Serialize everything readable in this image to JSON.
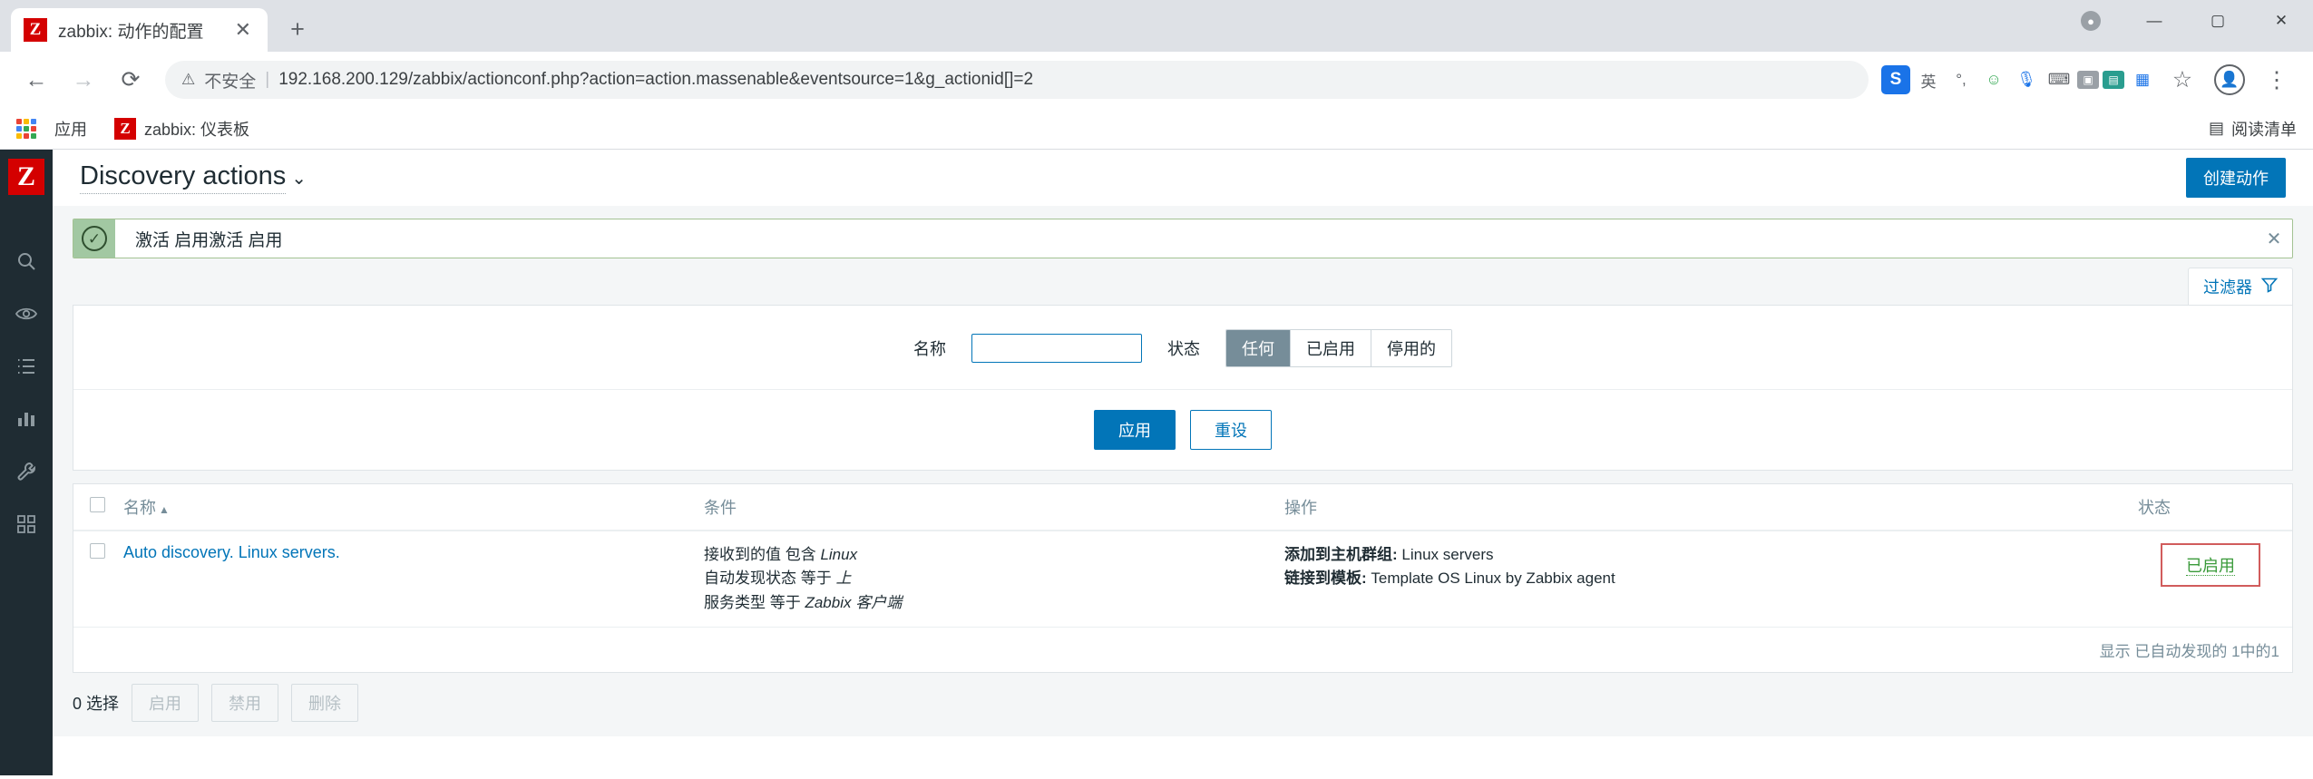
{
  "browser": {
    "tab": {
      "title": "zabbix: 动作的配置",
      "favicon_letter": "Z",
      "close_icon": "✕"
    },
    "new_tab_label": "+",
    "window_controls": {
      "minimize": "—",
      "maximize": "▢",
      "close": "✕",
      "record_dot": "●"
    },
    "nav": {
      "back": "←",
      "forward": "→",
      "reload": "⟳"
    },
    "omnibox": {
      "warning_icon": "⚠",
      "insecure_label": "不安全",
      "separator": "|",
      "url": "192.168.200.129/zabbix/actionconf.php?action=action.massenable&eventsource=1&g_actionid[]=2"
    },
    "extensions": {
      "sogou": "S",
      "ime_label": "英",
      "punct": "°,",
      "smiley": "☺",
      "mic": "🎙",
      "keyboard": "⌨",
      "camera": "▣",
      "gift": "▤",
      "apps": "▦"
    },
    "actions": {
      "star": "☆",
      "profile": "👤",
      "menu": "⋮"
    },
    "bookmarks": {
      "apps_label": "应用",
      "items": [
        {
          "label": "zabbix: 仪表板",
          "favicon_letter": "Z"
        }
      ],
      "reading_list_icon": "▤",
      "reading_list_label": "阅读清单"
    }
  },
  "sidebar": {
    "logo": "Z",
    "items": [
      {
        "name": "search",
        "glyph": "search-icon"
      },
      {
        "name": "monitoring",
        "glyph": "eye-icon"
      },
      {
        "name": "inventory",
        "glyph": "list-icon"
      },
      {
        "name": "reports",
        "glyph": "chart-icon"
      },
      {
        "name": "configuration",
        "glyph": "wrench-icon"
      },
      {
        "name": "administration",
        "glyph": "grid-icon"
      }
    ]
  },
  "header": {
    "title": "Discovery actions",
    "caret": "⌄",
    "create_button": "创建动作"
  },
  "message": {
    "icon": "✓",
    "text": "激活 启用激活 启用",
    "close": "✕"
  },
  "filter": {
    "tab_label": "过滤器",
    "tab_icon": "filter-icon",
    "name_label": "名称",
    "name_value": "",
    "name_placeholder": "",
    "status_label": "状态",
    "status_options": [
      "任何",
      "已启用",
      "停用的"
    ],
    "status_selected": "任何",
    "apply_label": "应用",
    "reset_label": "重设"
  },
  "table": {
    "headers": {
      "name": "名称",
      "sort_arrow": "▲",
      "conditions": "条件",
      "operations": "操作",
      "status": "状态"
    },
    "rows": [
      {
        "name": "Auto discovery. Linux servers.",
        "conditions": [
          {
            "label": "接收到的值 包含 ",
            "value": "Linux"
          },
          {
            "label": "自动发现状态 等于 ",
            "value": "上"
          },
          {
            "label": "服务类型 等于 ",
            "value": "Zabbix 客户端"
          }
        ],
        "operations": [
          {
            "label": "添加到主机群组:",
            "value": "Linux servers"
          },
          {
            "label": "链接到模板:",
            "value": "Template OS Linux by Zabbix agent"
          }
        ],
        "status": "已启用"
      }
    ],
    "footer_text": "显示 已自动发现的 1中的1"
  },
  "action_bar": {
    "selected_text": "0 选择",
    "enable_label": "启用",
    "disable_label": "禁用",
    "delete_label": "删除"
  },
  "colors": {
    "accent": "#0275b8",
    "sidebar_bg": "#1f2c33",
    "success_bg": "#a2c8a2",
    "success_border": "#a3c293",
    "status_enabled": "#3a9a3a",
    "highlight_border": "#d15c5c",
    "brand_red": "#d40000"
  }
}
